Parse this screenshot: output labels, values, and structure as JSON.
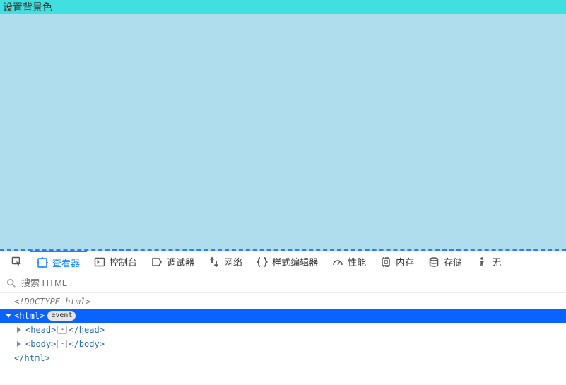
{
  "page": {
    "title": "设置背景色"
  },
  "devtools": {
    "tabs": {
      "inspector": "查看器",
      "console": "控制台",
      "debugger": "调试器",
      "network": "网络",
      "style_editor": "样式编辑器",
      "performance": "性能",
      "memory": "内存",
      "storage": "存储",
      "accessibility": "无"
    },
    "search_placeholder": "搜索 HTML",
    "tree": {
      "doctype": "<!DOCTYPE html>",
      "html_open": "<html>",
      "event_badge": "event",
      "head_open": "<head>",
      "head_close": "</head>",
      "body_open": "<body>",
      "body_close": "</body>",
      "html_close": "</html>",
      "ellipsis": "⋯"
    }
  },
  "colors": {
    "title_bar": "#40E0E0",
    "page_bg": "#B0DDEE",
    "accent": "#0a84ff",
    "selection": "#0a62ff"
  }
}
